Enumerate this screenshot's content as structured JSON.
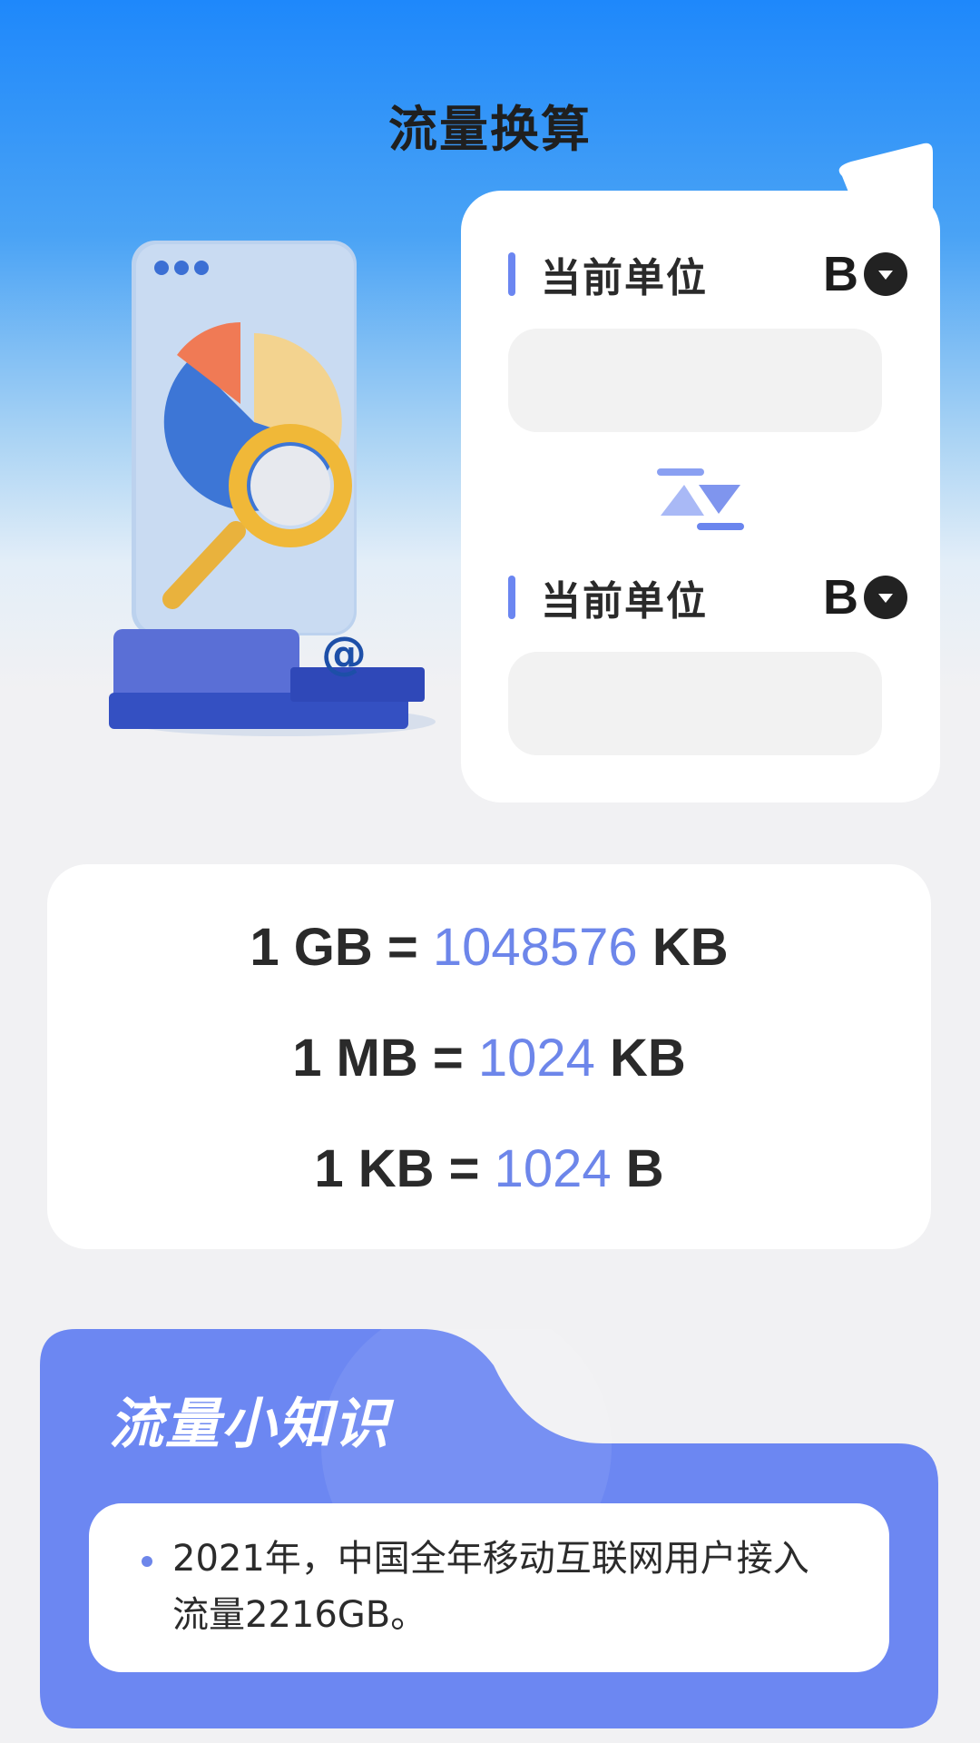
{
  "header": {
    "title": "流量换算"
  },
  "converter": {
    "from": {
      "label": "当前单位",
      "unit": "B",
      "value": ""
    },
    "to": {
      "label": "当前单位",
      "unit": "B",
      "value": ""
    }
  },
  "formulas": [
    {
      "left": "1 GB =",
      "number": "1048576",
      "unit": "KB"
    },
    {
      "left": "1 MB =",
      "number": "1024",
      "unit": "KB"
    },
    {
      "left": "1 KB =",
      "number": "1024",
      "unit": "B"
    }
  ],
  "knowledge": {
    "title": "流量小知识",
    "tip": "2021年，中国全年移动互联网用户接入流量2216GB。"
  },
  "colors": {
    "accent": "#6d86ea",
    "header_gradient_top": "#1e88fb",
    "background": "#f1f1f3",
    "knowledge_panel": "#6c87f2"
  },
  "icons": {
    "swap": "swap-arrows-icon",
    "dropdown": "caret-down-icon",
    "illustration": "chart-magnifier-illustration"
  }
}
